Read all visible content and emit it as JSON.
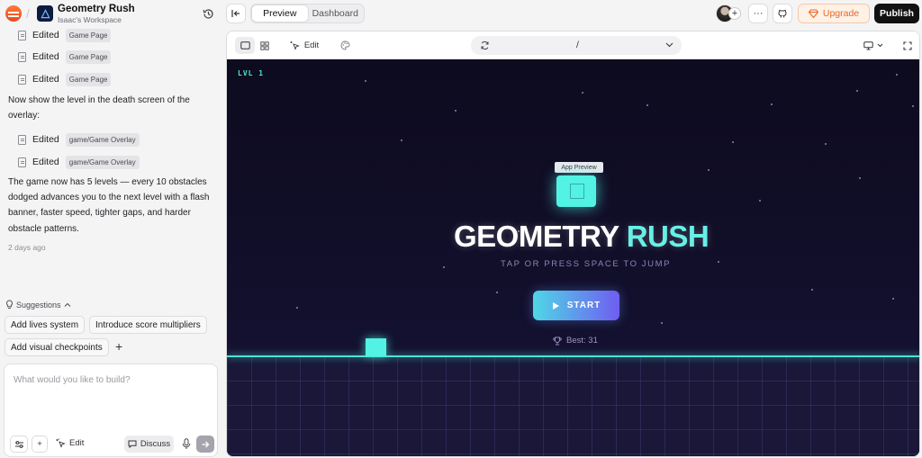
{
  "app": {
    "project_name": "Geometry Rush",
    "workspace": "Isaac's Workspace"
  },
  "header": {
    "tabs": [
      "Preview",
      "Dashboard"
    ],
    "active_tab": "Preview",
    "more_label": "···",
    "upgrade_label": "Upgrade",
    "publish_label": "Publish"
  },
  "chat": {
    "edits_top": [
      {
        "verb": "Edited",
        "tag": "Game Page"
      },
      {
        "verb": "Edited",
        "tag": "Game Page"
      },
      {
        "verb": "Edited",
        "tag": "Game Page"
      }
    ],
    "message_1": "Now show the level in the death screen of the overlay:",
    "edits_bottom": [
      {
        "verb": "Edited",
        "tag": "game/Game Overlay"
      },
      {
        "verb": "Edited",
        "tag": "game/Game Overlay"
      }
    ],
    "message_2": "The game now has 5 levels — every 10 obstacles dodged advances you to the next level with a flash banner, faster speed, tighter gaps, and harder obstacle patterns.",
    "timestamp": "2 days ago"
  },
  "suggestions": {
    "heading": "Suggestions",
    "items": [
      "Add lives system",
      "Introduce score multipliers",
      "Add visual checkpoints"
    ],
    "add_label": "+"
  },
  "composer": {
    "placeholder": "What would you like to build?",
    "add_label": "+",
    "edit_label": "Edit",
    "discuss_label": "Discuss"
  },
  "preview_toolbar": {
    "edit_label": "Edit",
    "url": "/"
  },
  "game": {
    "level_label": "LVL 1",
    "tooltip": "App Preview",
    "title_main": "GEOMETRY",
    "title_accent": "RUSH",
    "subtitle": "TAP OR PRESS SPACE TO JUMP",
    "start_label": "START",
    "best_label": "Best: 31"
  },
  "colors": {
    "accent_cyan": "#52f2e4",
    "upgrade_orange": "#e26a2c",
    "publish_bg": "#111111",
    "game_bg": "#0d0b1e"
  }
}
